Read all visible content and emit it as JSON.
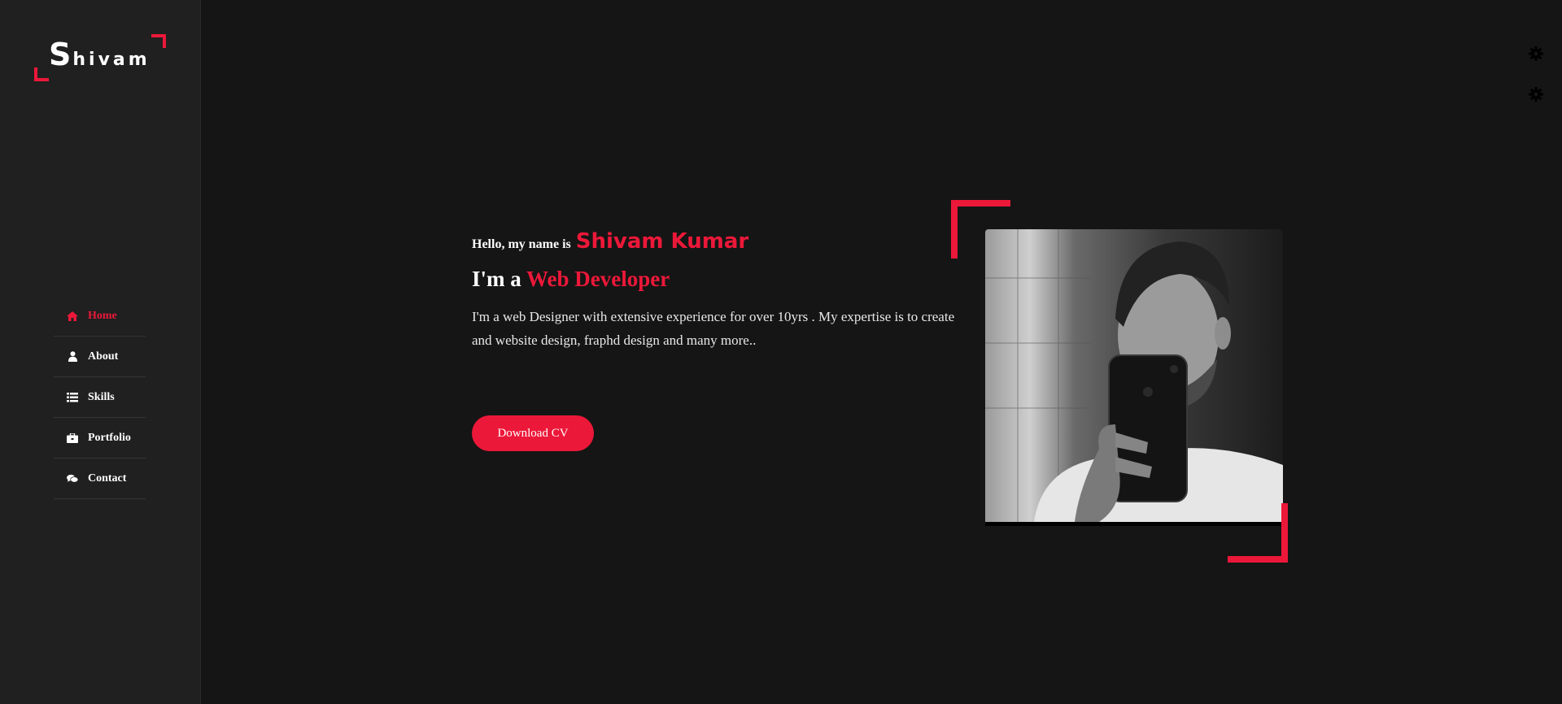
{
  "logo": {
    "initial": "S",
    "rest": "hivam"
  },
  "nav": {
    "items": [
      {
        "label": "Home",
        "icon": "home-icon",
        "active": true
      },
      {
        "label": "About",
        "icon": "user-icon",
        "active": false
      },
      {
        "label": "Skills",
        "icon": "list-icon",
        "active": false
      },
      {
        "label": "Portfolio",
        "icon": "briefcase-icon",
        "active": false
      },
      {
        "label": "Contact",
        "icon": "comments-icon",
        "active": false
      }
    ]
  },
  "hero": {
    "greeting_prefix": "Hello, my name is",
    "name": "Shivam Kumar",
    "role_prefix": "I'm a",
    "role": "Web Developer",
    "description": "I'm a web Designer with extensive experience for over 10yrs . My expertise is to create and website design, fraphd design and many more..",
    "button_label": "Download CV"
  },
  "colors": {
    "accent": "#ec1839",
    "background": "#151515",
    "sidebar": "#202020"
  },
  "settings": {
    "icons": [
      "gear-icon",
      "gear-icon"
    ]
  }
}
